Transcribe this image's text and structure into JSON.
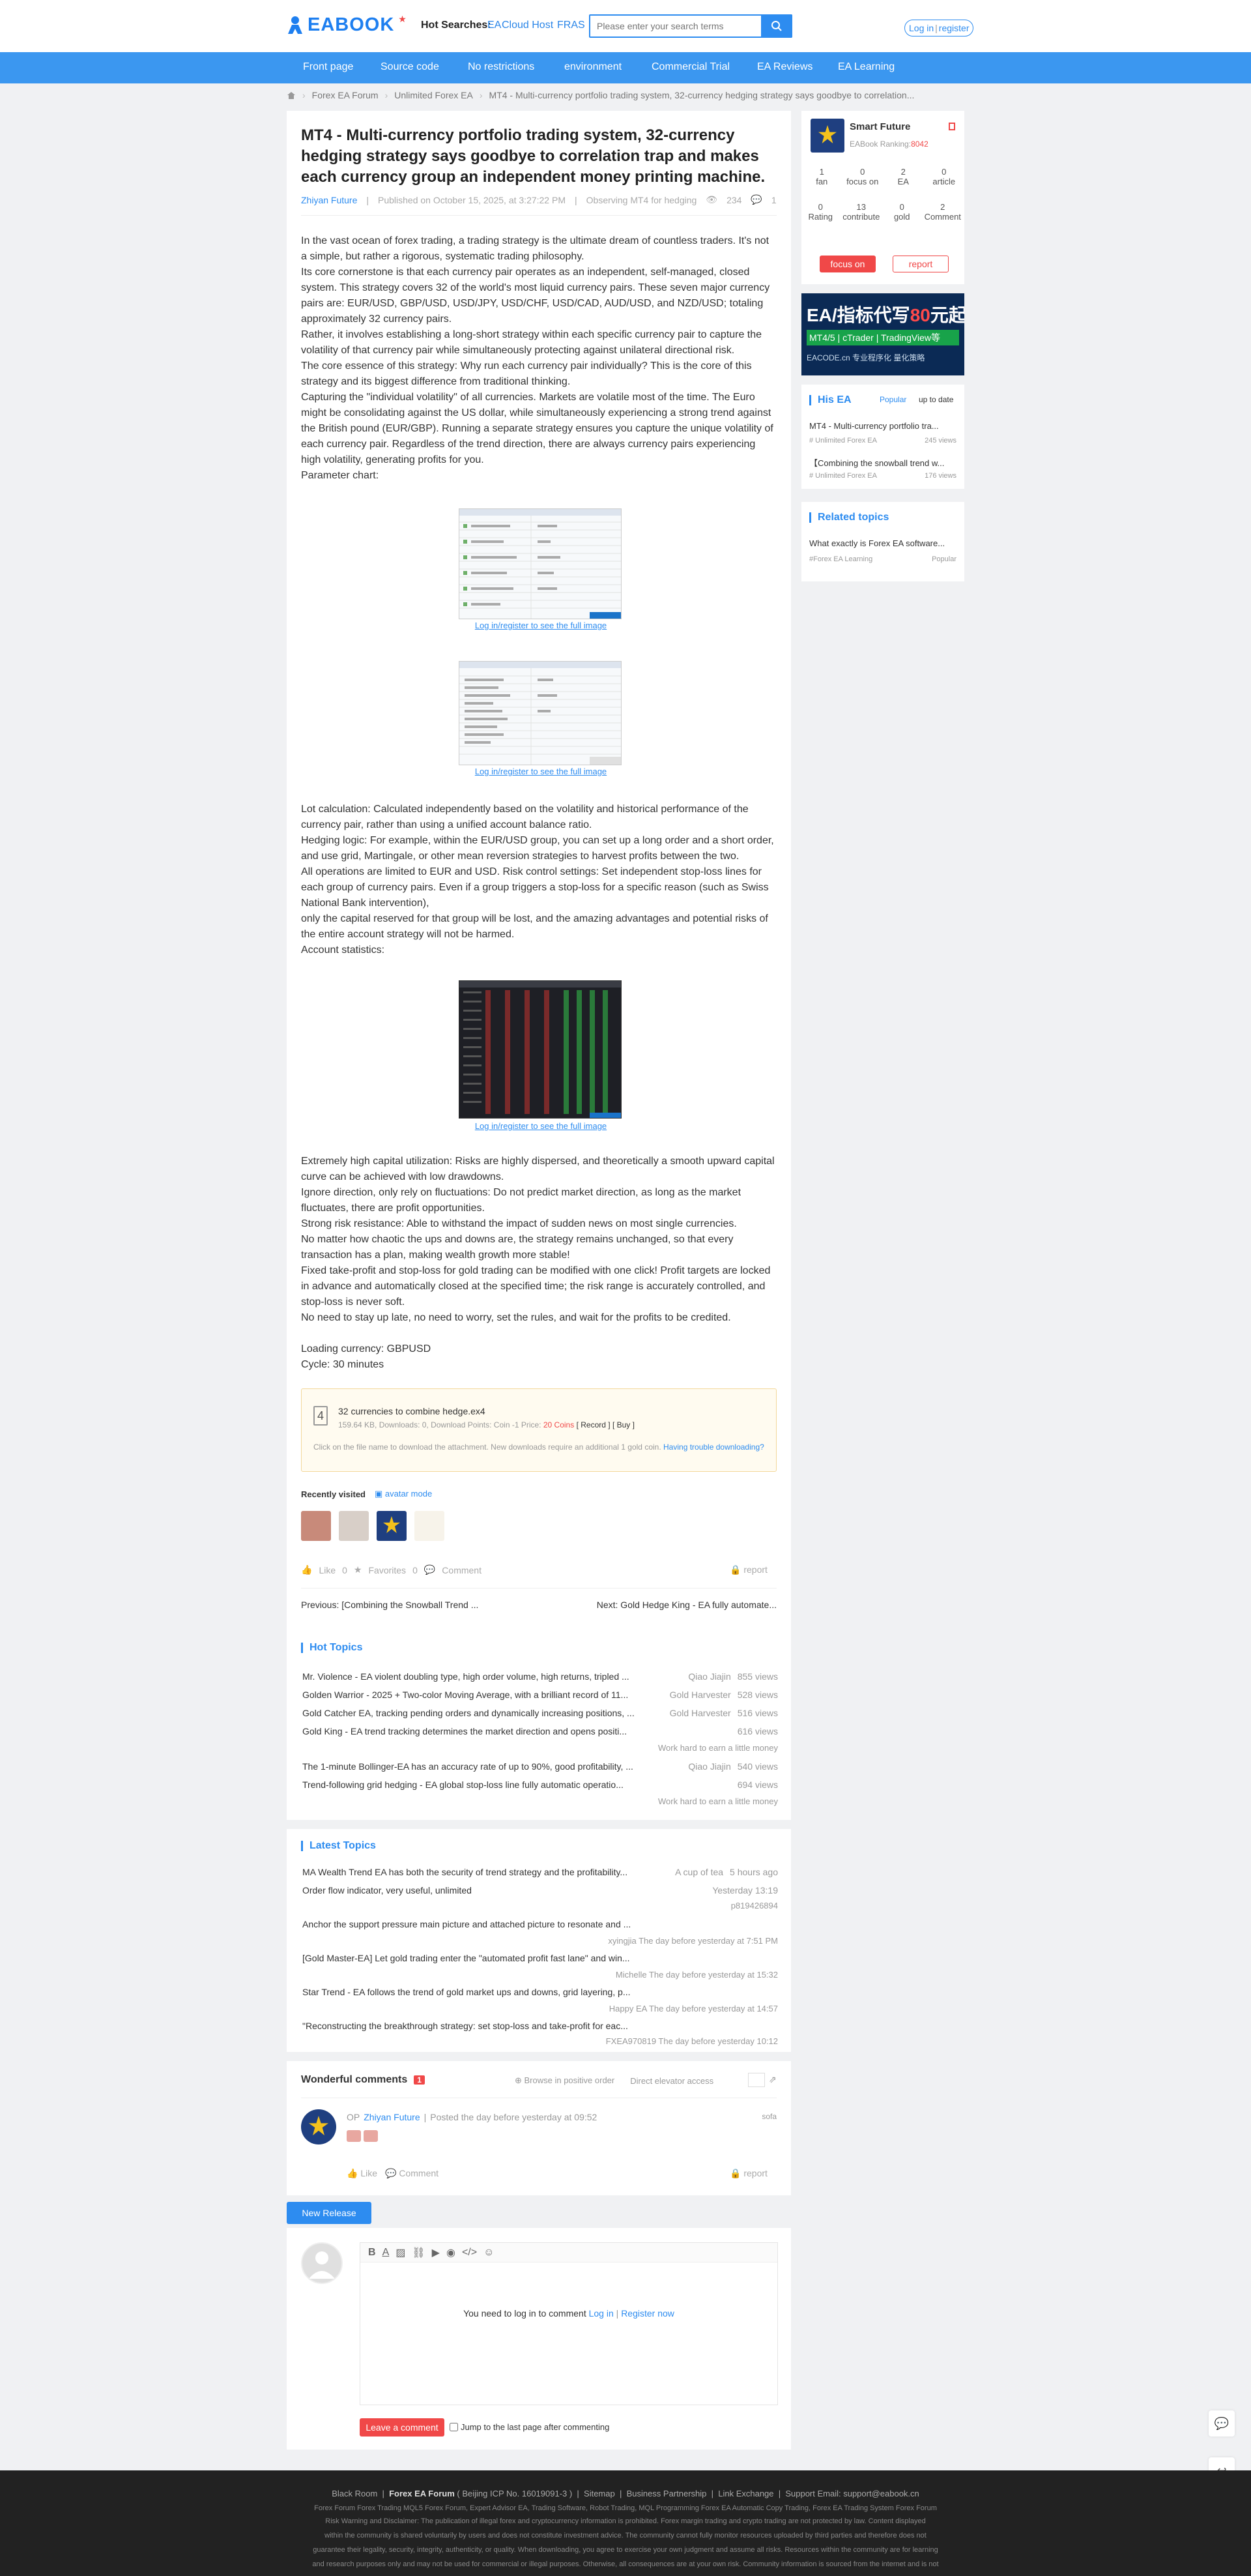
{
  "header": {
    "logo": "EABOOK",
    "hot_searches_label": "Hot Searches:",
    "hot_links": [
      "EA",
      "Cloud Host",
      "FRAS"
    ],
    "search_placeholder": "Please enter your search terms",
    "login": "Log in",
    "register": "register"
  },
  "nav": [
    "Front page",
    "Source code",
    "No restrictions",
    "environment",
    "Commercial Trial",
    "EA Reviews",
    "EA Learning"
  ],
  "breadcrumb": [
    "Forex EA Forum",
    "Unlimited Forex EA",
    "MT4 - Multi-currency portfolio trading system, 32-currency hedging strategy says goodbye to correlation..."
  ],
  "post": {
    "title": "MT4 - Multi-currency portfolio trading system, 32-currency hedging strategy says goodbye to correlation trap and makes each currency group an independent money printing machine.",
    "author": "Zhiyan Future",
    "published": "Published on October 15, 2025, at 3:27:22 PM",
    "observing": "Observing MT4 for hedging",
    "views": "234",
    "comments": "1",
    "body_1": [
      "In the vast ocean of forex trading, a trading strategy is the ultimate dream of countless traders. It's not a simple, but rather a rigorous, systematic trading philosophy.",
      "Its core cornerstone is that each currency pair operates as an independent, self-managed, closed system. This strategy covers 32 of the world's most liquid currency pairs. These seven major currency pairs are: EUR/USD, GBP/USD, USD/JPY, USD/CHF, USD/CAD, AUD/USD, and NZD/USD; totaling approximately 32 currency pairs.",
      "Rather, it involves establishing a long-short strategy within each specific currency pair to capture the volatility of that currency pair while simultaneously protecting against unilateral directional risk.",
      "The core essence of this strategy: Why run each currency pair individually? This is the core of this strategy and its biggest difference from traditional thinking.",
      "Capturing the \"individual volatility\" of all currencies. Markets are volatile most of the time. The Euro might be consolidating against the US dollar, while simultaneously experiencing a strong trend against the British pound (EUR/GBP). Running a separate strategy ensures you capture the unique volatility of each currency pair. Regardless of the trend direction, there are always currency pairs experiencing high volatility, generating profits for you.",
      "Parameter chart:"
    ],
    "full_image_link": "Log in/register to see the full image",
    "body_2": [
      "Lot calculation: Calculated independently based on the volatility and historical performance of the currency pair, rather than using a unified account balance ratio.",
      "Hedging logic: For example, within the EUR/USD group, you can set up a long order and a short order, and use grid, Martingale, or other mean reversion strategies to harvest profits between the two.",
      "All operations are limited to EUR and USD. Risk control settings: Set independent stop-loss lines for each group of currency pairs. Even if a group triggers a stop-loss for a specific reason (such as Swiss National Bank intervention),",
      "only the capital reserved for that group will be lost, and the amazing advantages and potential risks of the entire account strategy will not be harmed.",
      "Account statistics:"
    ],
    "body_3": [
      "Extremely high capital utilization: Risks are highly dispersed, and theoretically a smooth upward capital curve can be achieved with low drawdowns.",
      "Ignore direction, only rely on fluctuations: Do not predict market direction, as long as the market fluctuates, there are profit opportunities.",
      "Strong risk resistance: Able to withstand the impact of sudden news on most single currencies.",
      "No matter how chaotic the ups and downs are, the strategy remains unchanged, so that every transaction has a plan, making wealth growth more stable!",
      "Fixed take-profit and stop-loss for gold trading can be modified with one click! Profit targets are locked in advance and automatically closed at the specified time; the risk range is accurately controlled, and stop-loss is never soft.",
      "No need to stay up late, no need to worry, set the rules, and wait for the profits to be credited."
    ],
    "body_4": [
      "Loading currency: GBPUSD",
      "Cycle: 30 minutes"
    ]
  },
  "attachment": {
    "name": "32 currencies to combine hedge.ex4",
    "info_prefix": "159.64 KB, Downloads: 0, Download Points: Coin -1 Price:",
    "price": "20 Coins",
    "record": "[ Record ]",
    "buy": "[ Buy ]",
    "note": "Click on the file name to download the attachment. New downloads require an additional 1 gold coin.",
    "trouble": "Having trouble downloading?"
  },
  "recent": {
    "label": "Recently visited",
    "mode": "avatar mode"
  },
  "actions": {
    "like": "Like",
    "like_count": "0",
    "fav": "Favorites",
    "fav_count": "0",
    "comment": "Comment",
    "report": "report"
  },
  "prevnext": {
    "prev": "Previous: [Combining the Snowball Trend ...",
    "next": "Next: Gold Hedge King - EA fully automate..."
  },
  "hot_topics": {
    "title": "Hot Topics",
    "items": [
      {
        "t": "Mr. Violence - EA violent doubling type, high order volume, high returns, tripled ...",
        "a": "Qiao Jiajin",
        "v": "855 views"
      },
      {
        "t": "Golden Warrior - 2025 + Two-color Moving Average, with a brilliant record of 11...",
        "a": "Gold Harvester",
        "v": "528 views"
      },
      {
        "t": "Gold Catcher EA, tracking pending orders and dynamically increasing positions, ...",
        "a": "Gold Harvester",
        "v": "516 views"
      },
      {
        "t": "Gold King - EA trend tracking determines the market direction and opens positi...",
        "a": "",
        "v": "616 views",
        "sub": "Work hard to earn a little money"
      },
      {
        "t": "The 1-minute Bollinger-EA has an accuracy rate of up to 90%, good profitability, ...",
        "a": "Qiao Jiajin",
        "v": "540 views"
      },
      {
        "t": "Trend-following grid hedging - EA global stop-loss line fully automatic operatio...",
        "a": "",
        "v": "694 views",
        "sub": "Work hard to earn a little money"
      }
    ]
  },
  "latest_topics": {
    "title": "Latest Topics",
    "items": [
      {
        "t": "MA Wealth Trend EA has both the security of trend strategy and the profitability...",
        "a": "A cup of tea",
        "time": "5 hours ago"
      },
      {
        "t": "Order flow indicator, very useful, unlimited",
        "a": "",
        "time": "Yesterday 13:19",
        "sub": "p819426894"
      },
      {
        "t": "Anchor the support pressure main picture and attached picture to resonate and ...",
        "a": "",
        "time": "",
        "sub": "xyingjia   The day before yesterday at 7:51 PM"
      },
      {
        "t": "[Gold Master-EA] Let gold trading enter the \"automated profit fast lane\" and win...",
        "a": "",
        "time": "",
        "sub": "Michelle   The day before yesterday at 15:32"
      },
      {
        "t": "Star Trend - EA follows the trend of gold market ups and downs, grid layering, p...",
        "a": "",
        "time": "",
        "sub": "Happy EA   The day before yesterday at 14:57"
      },
      {
        "t": "\"Reconstructing the breakthrough strategy: set stop-loss and take-profit for eac...",
        "a": "",
        "time": "",
        "sub": "FXEA970819   The day before yesterday 10:12"
      }
    ]
  },
  "comments": {
    "title": "Wonderful comments",
    "count": "1",
    "browse": "Browse in positive order",
    "elevator": "Direct elevator access",
    "op_tag": "OP",
    "author": "Zhiyan Future",
    "posted": "Posted the day before yesterday at 09:52",
    "floor": "sofa",
    "like": "Like",
    "comment": "Comment",
    "report": "report"
  },
  "editor": {
    "new_release": "New Release",
    "login_prompt": "You need to log in to comment",
    "login": "Log in",
    "register": "Register now",
    "submit": "Leave a comment",
    "jump": "Jump to the last page after commenting"
  },
  "sidebar": {
    "name": "Smart Future",
    "ranking_label": "EABook Ranking:",
    "ranking": "8042",
    "stats1": [
      {
        "n": "1",
        "l": "fan"
      },
      {
        "n": "0",
        "l": "focus on"
      },
      {
        "n": "2",
        "l": "EA"
      },
      {
        "n": "0",
        "l": "article"
      }
    ],
    "stats2": [
      {
        "n": "0",
        "l": "Rating"
      },
      {
        "n": "13",
        "l": "contribute"
      },
      {
        "n": "0",
        "l": "gold"
      },
      {
        "n": "2",
        "l": "Comment"
      }
    ],
    "follow": "focus on",
    "report": "report",
    "ad_line1": "EA/指标代写",
    "ad_price": "80",
    "ad_unit": "元起",
    "ad_line2": "MT4/5 | cTrader | TradingView等",
    "ad_line3": "EACODE.cn 专业程序化 量化策略",
    "his_ea": {
      "title": "His EA",
      "tabs": [
        "Popular",
        "up to date"
      ],
      "items": [
        {
          "t": "MT4 - Multi-currency portfolio tra...",
          "cat": "# Unlimited Forex EA",
          "v": "245 views"
        },
        {
          "t": "【Combining the snowball trend w...",
          "cat": "# Unlimited Forex EA",
          "v": "176 views"
        }
      ]
    },
    "related": {
      "title": "Related topics",
      "items": [
        {
          "t": "What exactly is Forex EA software...",
          "cat": "#Forex EA Learning",
          "tag": "Popular"
        }
      ]
    }
  },
  "footer": {
    "line1": [
      "Black Room",
      "Forex EA Forum",
      "( Beijing ICP No. 16019091-3 )",
      "Sitemap",
      "Business Partnership",
      "Link Exchange",
      "Support Email: support@eabook.cn"
    ],
    "line2": "Forex Forum    Forex Trading    MQL5 Forex Forum, Expert Advisor    EA, Trading Software, Robot Trading, MQL Programming    Forex EA Automatic Copy Trading, Forex EA Trading System    Forex Forum",
    "line3": "Risk Warning and Disclaimer: The publication of illegal forex and cryptocurrency information is prohibited. Forex margin trading and crypto trading are not protected by law. Content displayed",
    "line4": "within the community is shared voluntarily by users and does not constitute investment advice. The community cannot fully monitor resources uploaded by third parties and therefore does not",
    "line5": "guarantee their legality, security, integrity, authenticity, or quality. When downloading, you agree to exercise your own judgment and assume all risks. Resources within the community are for learning",
    "line6": "and research purposes only and may not be used for commercial or illegal purposes. Otherwise, all consequences are at your own risk. Community information is sourced from the internet and is not"
  }
}
